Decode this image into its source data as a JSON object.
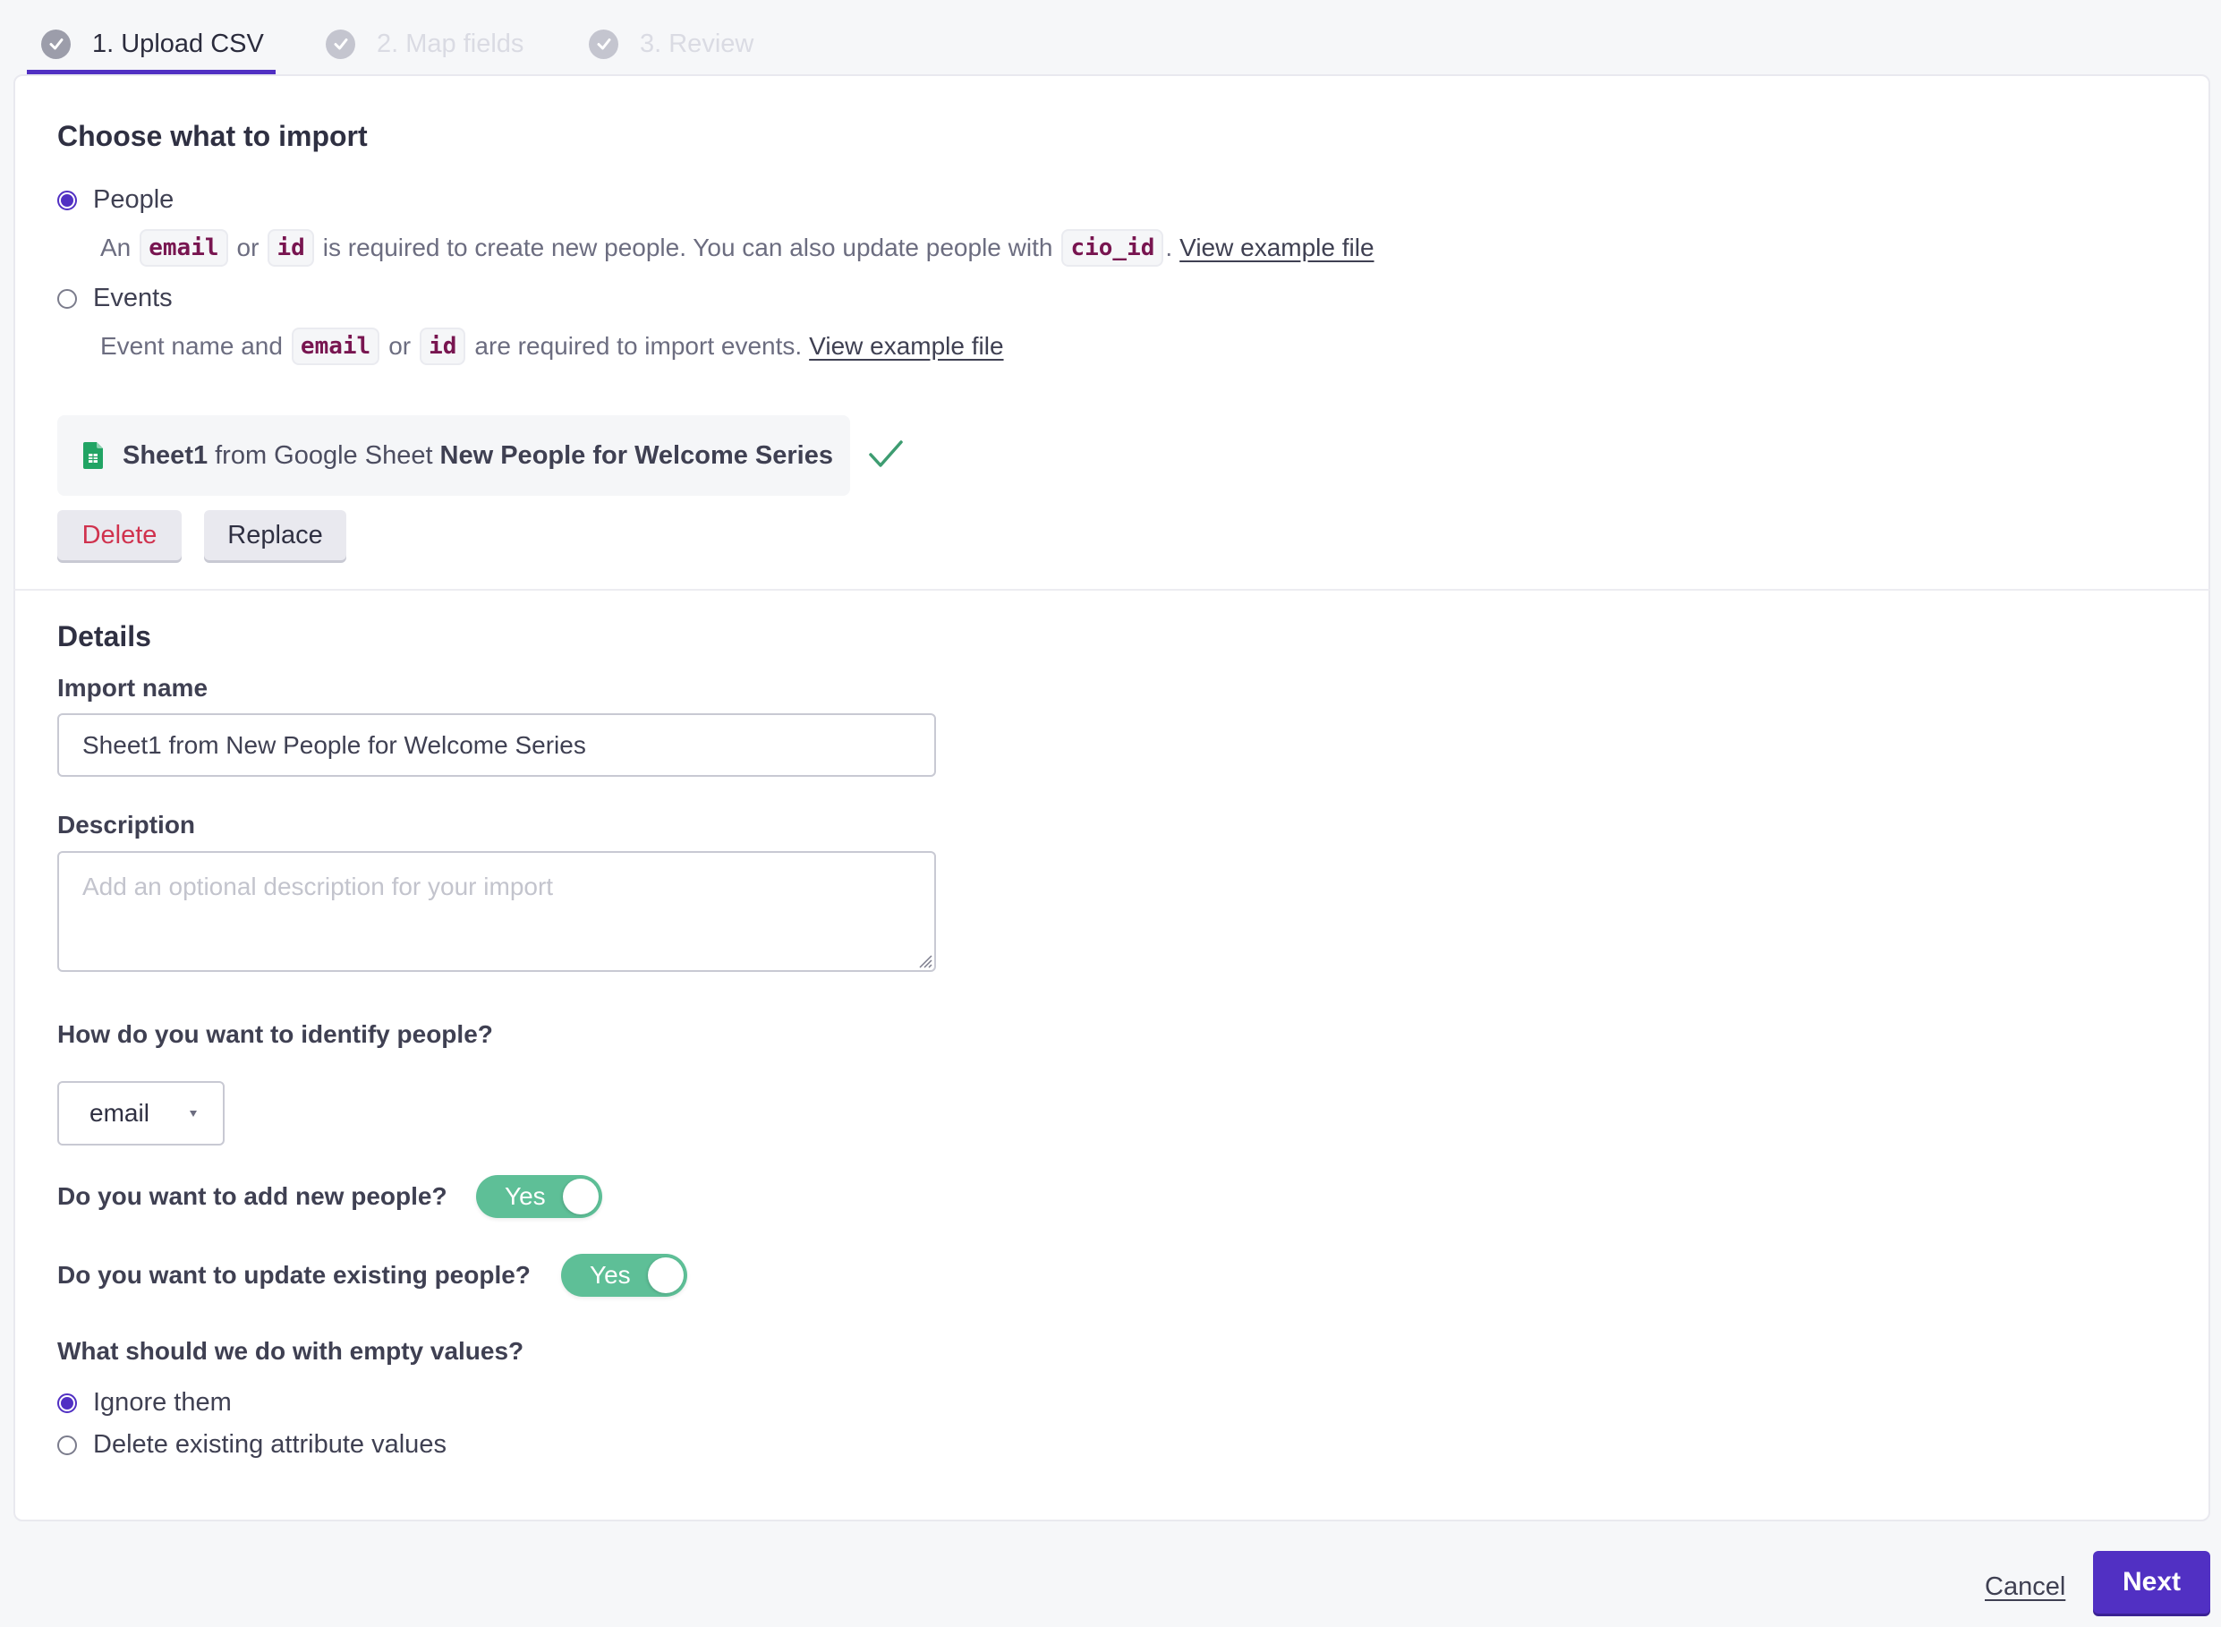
{
  "tabs": [
    {
      "label": "1. Upload CSV",
      "icon": "check-circle-icon",
      "active": true
    },
    {
      "label": "2. Map fields",
      "icon": "check-circle-icon",
      "active": false
    },
    {
      "label": "3. Review",
      "icon": "check-circle-icon",
      "active": false
    }
  ],
  "import_type": {
    "heading": "Choose what to import",
    "options": [
      {
        "label": "People",
        "checked": true,
        "help": {
          "part1": "An",
          "code1": "email",
          "part2": "or",
          "code2": "id",
          "part3": "is required to create new people. You can also update people with",
          "code3": "cio_id",
          "part4": ".",
          "link": "View example file"
        }
      },
      {
        "label": "Events",
        "checked": false,
        "help": {
          "part1": "Event name and",
          "code1": "email",
          "part2": "or",
          "code2": "id",
          "part3": "are required to import events.",
          "link": "View example file"
        }
      }
    ]
  },
  "source": {
    "icon": "google-sheets-icon",
    "sheet_name": "Sheet1",
    "middle_text": "from Google Sheet",
    "spreadsheet_name": "New People for Welcome Series",
    "status_icon": "check-icon",
    "status_color": "#3d9c71",
    "delete_label": "Delete",
    "replace_label": "Replace"
  },
  "details": {
    "heading": "Details",
    "import_name_label": "Import name",
    "import_name_value": "Sheet1 from New People for Welcome Series",
    "description_label": "Description",
    "description_placeholder": "Add an optional description for your import",
    "identify_label": "How do you want to identify people?",
    "identify_value": "email",
    "add_new_label": "Do you want to add new people?",
    "add_new_value": "Yes",
    "update_existing_label": "Do you want to update existing people?",
    "update_existing_value": "Yes",
    "empty_values_label": "What should we do with empty values?",
    "empty_values_options": [
      {
        "label": "Ignore them",
        "checked": true
      },
      {
        "label": "Delete existing attribute values",
        "checked": false
      }
    ]
  },
  "footer": {
    "cancel_label": "Cancel",
    "next_label": "Next"
  },
  "colors": {
    "accent": "#5130c3",
    "toggle_on": "#5ebf97",
    "danger": "#d0324e",
    "code_text": "#781550"
  }
}
